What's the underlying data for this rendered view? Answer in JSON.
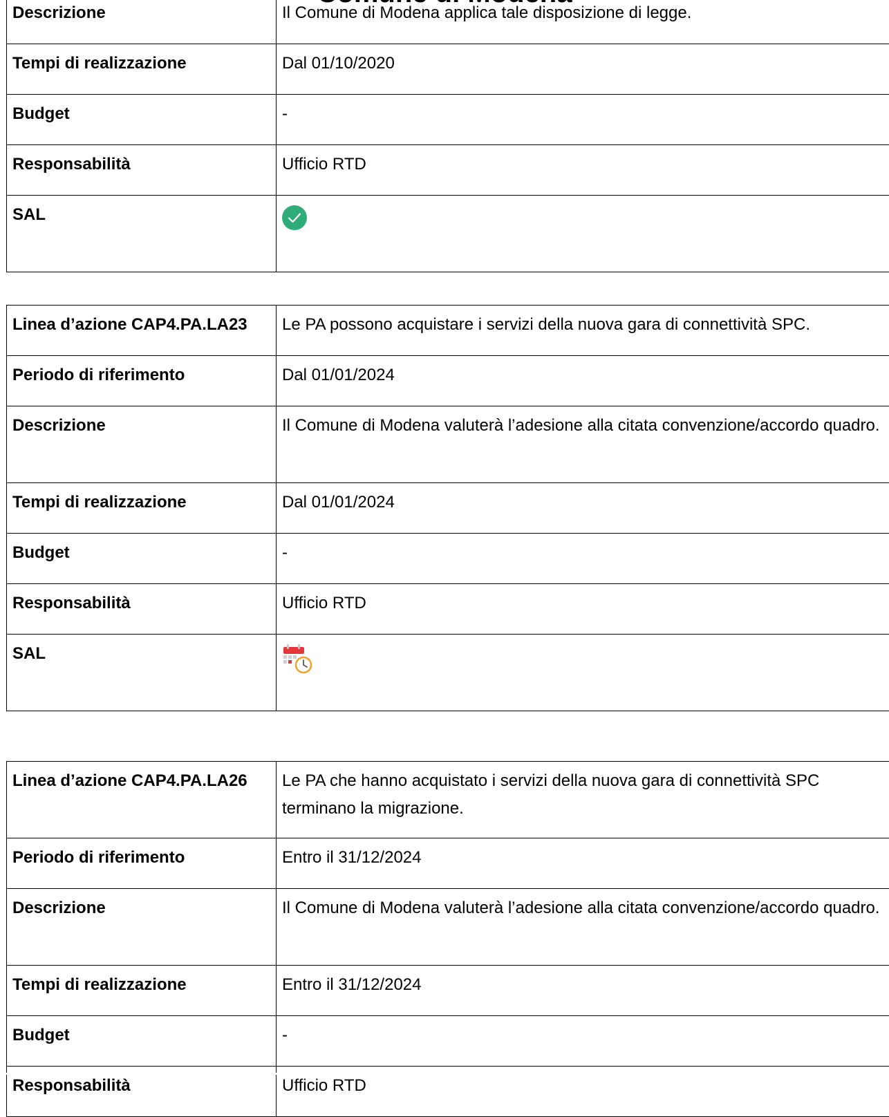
{
  "page": {
    "title": "Comune di Modena",
    "accent_green": "#2dab79",
    "calendar_red": "#e2363a",
    "clock_orange": "#f0a12a"
  },
  "table_a": {
    "rows": [
      {
        "label": "Descrizione",
        "value": "Il Comune di Modena applica tale disposizione di legge."
      },
      {
        "label": "Tempi di realizzazione",
        "value": "Dal 01/10/2020"
      },
      {
        "label": "Budget",
        "value": "-"
      },
      {
        "label": "Responsabilità",
        "value": "Ufficio RTD"
      },
      {
        "label": "SAL",
        "icon": "check-circle-icon"
      }
    ]
  },
  "table_b": {
    "rows": [
      {
        "label": "Linea d’azione CAP4.PA.LA23",
        "value": "Le PA possono acquistare i servizi della nuova gara di connettività SPC."
      },
      {
        "label": "Periodo di riferimento",
        "value": "Dal 01/01/2024"
      },
      {
        "label": "Descrizione",
        "value": "Il Comune di Modena valuterà l’adesione alla citata convenzione/accordo quadro."
      },
      {
        "label": "Tempi di realizzazione",
        "value": "Dal 01/01/2024"
      },
      {
        "label": "Budget",
        "value": "-"
      },
      {
        "label": "Responsabilità",
        "value": "Ufficio RTD"
      },
      {
        "label": "SAL",
        "icon": "calendar-clock-icon"
      }
    ]
  },
  "table_c": {
    "rows": [
      {
        "label": "Linea d’azione CAP4.PA.LA26",
        "value": "Le PA che hanno acquistato i servizi della nuova gara di connettività SPC terminano la migrazione."
      },
      {
        "label": "Periodo di riferimento",
        "value": "Entro il 31/12/2024"
      },
      {
        "label": "Descrizione",
        "value": "Il Comune di Modena valuterà l’adesione alla citata convenzione/accordo quadro."
      },
      {
        "label": "Tempi di realizzazione",
        "value": "Entro il 31/12/2024"
      },
      {
        "label": "Budget",
        "value": "-"
      },
      {
        "label": "Responsabilità",
        "value": "Ufficio RTD"
      }
    ]
  }
}
